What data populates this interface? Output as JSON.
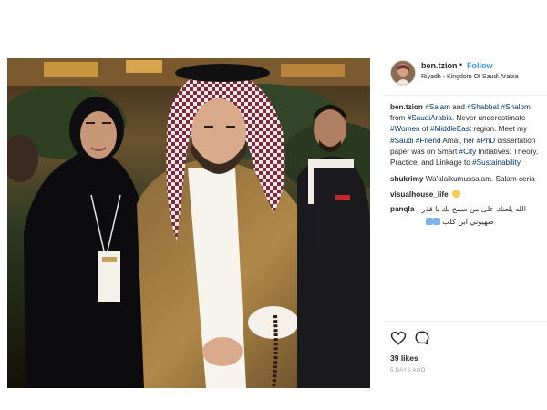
{
  "post": {
    "username": "ben.tzion",
    "separator": "•",
    "follow_label": "Follow",
    "location": "Riyadh - Kingdom Of Saudi Arabia",
    "caption_user": "ben.tzion",
    "caption": {
      "tag_salam": "#Salam",
      "and_1": " and ",
      "tag_shabbat": "#Shabbat",
      "tag_shalom": "#Shalom",
      "from": "from ",
      "tag_saudiarabia": "#SaudiArabia",
      "never": ". Never underestimate",
      "tag_women": "#Women",
      "of": " of ",
      "tag_middleeast": "#MiddleEast",
      "region_meet": " region. Meet my",
      "tag_saudi": "#Saudi",
      "tag_friend": "#Friend",
      "amal_her": " Amal, her ",
      "tag_phd": "#PhD",
      "dissertation": " dissertation",
      "paper_on": "paper was on Smart ",
      "tag_city": "#City",
      "initiatives": " Initiatives: Theory,",
      "practice": "Practice, and Linkage to ",
      "tag_sustainability": "#Sustainability",
      "period": "."
    },
    "comments": [
      {
        "user": "shukrimy",
        "text": "Wa'alaikumussalam. Salam ceria"
      },
      {
        "user": "visualhouse_life",
        "text": ""
      },
      {
        "user": "panqla",
        "text": "الله يلعنك على من سمح لك يا قذر",
        "text2": "صهيوني ابن كلب"
      }
    ],
    "likes": "39 likes",
    "time_ago": "5 DAYS AGO",
    "icons": {
      "like": "heart-icon",
      "comment": "comment-bubble-icon"
    }
  }
}
